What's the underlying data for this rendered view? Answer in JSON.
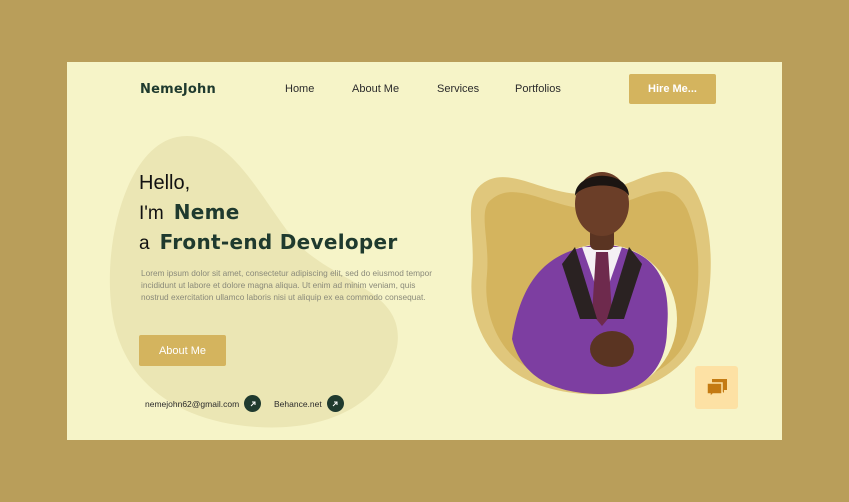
{
  "brand": {
    "logo": "NemeJohn"
  },
  "nav": {
    "items": [
      "Home",
      "About Me",
      "Services",
      "Portfolios"
    ]
  },
  "header": {
    "hire_label": "Hire Me..."
  },
  "hero": {
    "greeting": "Hello,",
    "im_prefix": "I'm",
    "name": "Neme",
    "a_prefix": "a",
    "role": "Front-end Developer",
    "description": "Lorem ipsum dolor sit amet, consectetur adipiscing elit, sed do eiusmod tempor incididunt ut labore et dolore magna aliqua. Ut enim ad minim veniam, quis nostrud exercitation ullamco laboris nisi ut aliquip ex ea commodo consequat.",
    "about_label": "About Me"
  },
  "contacts": {
    "email": "nemejohn62@gmail.com",
    "behance": "Behance.net"
  },
  "icons": {
    "arrow": "arrow-up-right-icon",
    "chat": "chat-bubbles-icon"
  },
  "colors": {
    "accent": "#d4b45e",
    "dark": "#1f3a2e",
    "card": "#f6f4c8",
    "background": "#b99e5a"
  }
}
